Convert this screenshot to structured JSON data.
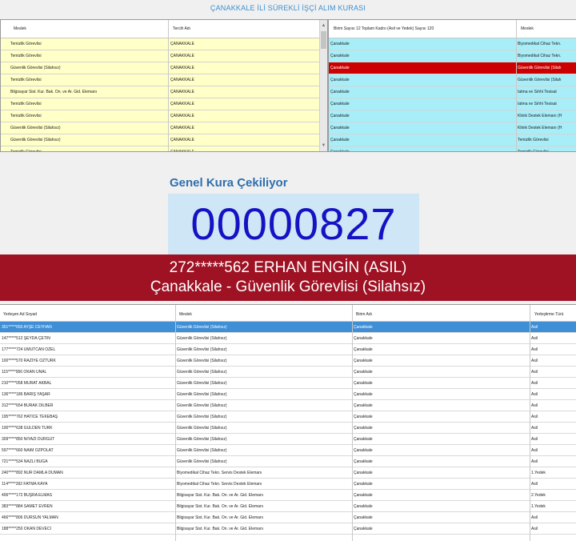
{
  "window": {
    "title": "ÇANAKKALE İLİ SÜREKLİ İŞÇİ ALIM KURASI"
  },
  "left_grid": {
    "headers": [
      "Meslek",
      "Tercih Adı"
    ],
    "rows": [
      [
        "Temizlik Görevlisi",
        "ÇANAKKALE"
      ],
      [
        "Temizlik Görevlisi",
        "ÇANAKKALE"
      ],
      [
        "Güvenlik Görevlisi (Silahsız)",
        "ÇANAKKALE"
      ],
      [
        "Temizlik Görevlisi",
        "ÇANAKKALE"
      ],
      [
        "Bilgisayar Sist. Kur. Bak. On. ve Ar. Gid. Elemanı",
        "ÇANAKKALE"
      ],
      [
        "Temizlik Görevlisi",
        "ÇANAKKALE"
      ],
      [
        "Temizlik Görevlisi",
        "ÇANAKKALE"
      ],
      [
        "Güvenlik Görevlisi (Silahsız)",
        "ÇANAKKALE"
      ],
      [
        "Güvenlik Görevlisi (Silahsız)",
        "ÇANAKKALE"
      ],
      [
        "Temizlik Görevlisi",
        "ÇANAKKALE"
      ]
    ]
  },
  "right_grid": {
    "headers": [
      "Birim Sayısı 12 Toplam Kadro (Asil ve Yedek) Sayısı 120",
      "Meslek"
    ],
    "selected_row": 2,
    "rows": [
      [
        "Çanakkale",
        "Biyomedikal Cihaz Tekn."
      ],
      [
        "Çanakkale",
        "Biyomedikal Cihaz Tekn."
      ],
      [
        "Çanakkale",
        "Güvenlik Görevlisi (Silah"
      ],
      [
        "Çanakkale",
        "Güvenlik Görevlisi (Silah"
      ],
      [
        "Çanakkale",
        "Iatma ve Sıhhi Tesisat"
      ],
      [
        "Çanakkale",
        "Iatma ve Sıhhi Tesisat"
      ],
      [
        "Çanakkale",
        "Klinik Destek Elemanı (H"
      ],
      [
        "Çanakkale",
        "Klinik Destek Elemanı (H"
      ],
      [
        "Çanakkale",
        "Temizlik Görevlisi"
      ],
      [
        "Çanakkale",
        "Temizlik Görevlisi"
      ]
    ]
  },
  "draw": {
    "subtitle": "Genel Kura Çekiliyor",
    "number": "00000827"
  },
  "winner": {
    "line1": "272*****562 ERHAN ENGİN (ASIL)",
    "line2": "Çanakkale - Güvenlik Görevlisi (Silahsız)"
  },
  "results_grid": {
    "headers": [
      "Yerleşen Ad Soyad",
      "Meslek",
      "Birim Adı",
      "Yerleştirme Türü"
    ],
    "selected_row": 0,
    "rows": [
      [
        "351*****650 AYŞE CEYHAN",
        "Güvenlik Görevlisi (Silahsız)",
        "Çanakkale",
        "Asil"
      ],
      [
        "147*****512 ŞEYDA ÇETİN",
        "Güvenlik Görevlisi (Silahsız)",
        "Çanakkale",
        "Asil"
      ],
      [
        "177*****724 UMUTCAN ÖZEL",
        "Güvenlik Görevlisi (Silahsız)",
        "Çanakkale",
        "Asil"
      ],
      [
        "100*****570 RAZİYE ÖZTÜRK",
        "Güvenlik Görevlisi (Silahsız)",
        "Çanakkale",
        "Asil"
      ],
      [
        "115*****956 OKAN ÜNAL",
        "Güvenlik Görevlisi (Silahsız)",
        "Çanakkale",
        "Asil"
      ],
      [
        "210*****058 MURAT AKBAL",
        "Güvenlik Görevlisi (Silahsız)",
        "Çanakkale",
        "Asil"
      ],
      [
        "136*****186 BARIŞ YAŞAR",
        "Güvenlik Görevlisi (Silahsız)",
        "Çanakkale",
        "Asil"
      ],
      [
        "312*****654 BURAK DİLBER",
        "Güvenlik Görevlisi (Silahsız)",
        "Çanakkale",
        "Asil"
      ],
      [
        "195*****762 HATİCE TEKEBAŞ",
        "Güvenlik Görevlisi (Silahsız)",
        "Çanakkale",
        "Asil"
      ],
      [
        "100*****638 GÜLDEN TÜRK",
        "Güvenlik Görevlisi (Silahsız)",
        "Çanakkale",
        "Asil"
      ],
      [
        "309*****850 NİYAZİ DURGUT",
        "Güvenlik Görevlisi (Silahsız)",
        "Çanakkale",
        "Asil"
      ],
      [
        "597*****660 NAİM ÖZPOLAT",
        "Güvenlik Görevlisi (Silahsız)",
        "Çanakkale",
        "Asil"
      ],
      [
        "721*****534 NAZLI BUĞA",
        "Güvenlik Görevlisi (Silahsız)",
        "Çanakkale",
        "Asil"
      ],
      [
        "240*****892 NUR DAMLA DUMAN",
        "Biyomedikal Cihaz Tekn. Servis Destek Elemanı",
        "Çanakkale",
        "1.Yedek"
      ],
      [
        "114*****392 FATMA KAYA",
        "Biyomedikal Cihaz Tekn. Servis Destek Elemanı",
        "Çanakkale",
        "Asil"
      ],
      [
        "406*****172 BÜŞRA ELMAS",
        "Bilgisayar Sist. Kur. Bak. On. ve Ar. Gid. Elemanı",
        "Çanakkale",
        "2.Yedek"
      ],
      [
        "383*****884 SAMET EVREN",
        "Bilgisayar Sist. Kur. Bak. On. ve Ar. Gid. Elemanı",
        "Çanakkale",
        "1.Yedek"
      ],
      [
        "466*****806 DURSUN YALMAN",
        "Bilgisayar Sist. Kur. Bak. On. ve Ar. Gid. Elemanı",
        "Çanakkale",
        "Asil"
      ],
      [
        "188*****250 OKAN DEVECİ",
        "Bilgisayar Sist. Kur. Bak. On. ve Ar. Gid. Elemanı",
        "Çanakkale",
        "Asil"
      ]
    ]
  },
  "colors": {
    "left_row_bg": "#ffffc8",
    "right_row_bg": "#a8eef8",
    "right_selected_bg": "#cc0000",
    "results_selected_bg": "#3f8fd6",
    "banner_bg": "#9e1224",
    "counter_text": "#1313c4",
    "title_text": "#3b8fd0"
  },
  "icons": [
    "scroll-up-arrow-icon",
    "scroll-down-arrow-icon"
  ]
}
